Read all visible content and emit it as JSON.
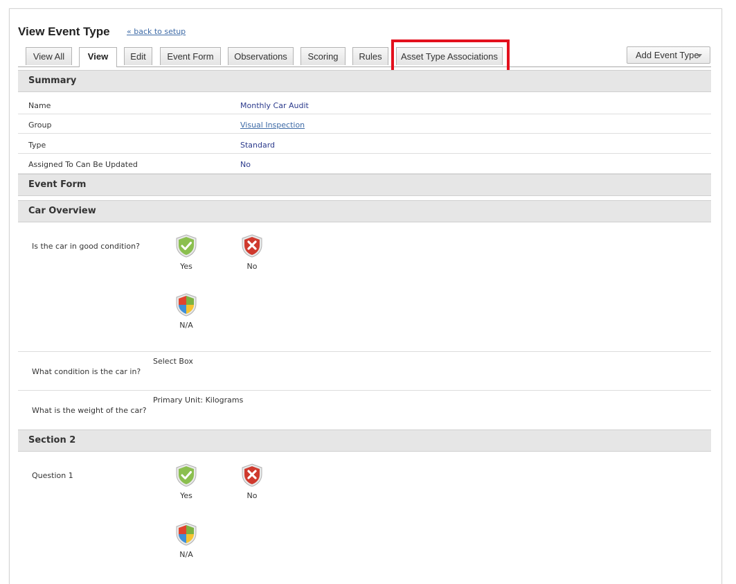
{
  "page": {
    "title": "View Event Type",
    "back_link": "« back to setup"
  },
  "tabs": [
    {
      "label": "View All"
    },
    {
      "label": "View",
      "active": true
    },
    {
      "label": "Edit"
    },
    {
      "label": "Event Form"
    },
    {
      "label": "Observations"
    },
    {
      "label": "Scoring"
    },
    {
      "label": "Rules"
    },
    {
      "label": "Asset Type Associations"
    }
  ],
  "add_event_type_label": "Add Event Type",
  "summary": {
    "header": "Summary",
    "rows": [
      {
        "label": "Name",
        "value": "Monthly Car Audit"
      },
      {
        "label": "Group",
        "value": "Visual Inspection"
      },
      {
        "label": "Type",
        "value": "Standard"
      },
      {
        "label": "Assigned To Can Be Updated",
        "value": "No"
      }
    ]
  },
  "event_form": {
    "header": "Event Form",
    "sections": [
      {
        "header": "Car Overview",
        "questions": [
          {
            "text": "Is the car in good condition?",
            "options": [
              "Yes",
              "No",
              "N/A"
            ]
          },
          {
            "text": "What condition is the car in?",
            "field_type": "Select Box"
          },
          {
            "text": "What is the weight of the car?",
            "field_type": "Primary Unit: Kilograms"
          }
        ]
      },
      {
        "header": "Section 2",
        "questions": [
          {
            "text": "Question 1",
            "options": [
              "Yes",
              "No",
              "N/A"
            ]
          }
        ]
      }
    ]
  },
  "colors": {
    "highlight": "#e3101d",
    "link": "#3d6aa6",
    "value": "#2b3a8c",
    "pass_green": "#7cb342",
    "fail_red": "#c62828"
  }
}
